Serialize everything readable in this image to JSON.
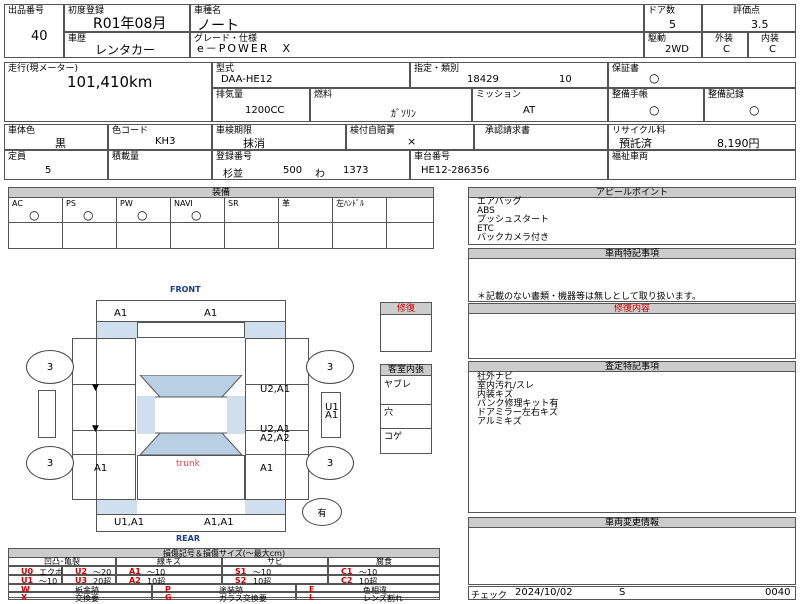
{
  "header": {
    "lot_label": "出品番号",
    "lot_value": "40",
    "first_reg_label": "初度登録",
    "first_reg_value": "R01年08月",
    "car_name_label": "車種名",
    "car_name_value": "ノート",
    "doors_label": "ドア数",
    "doors_value": "5",
    "score_label": "評価点",
    "score_value": "3.5",
    "history_label": "車歴",
    "history_value": "レンタカー",
    "grade_label": "グレード・仕様",
    "grade_value": "e－POWER　X",
    "drive_label": "駆動",
    "drive_value": "2WD",
    "ext_label": "外装",
    "ext_value": "C",
    "int_label": "内装",
    "int_value": "C"
  },
  "spec": {
    "mileage_label": "走行(現メーター)",
    "mileage_value": "101,410km",
    "model_label": "型式",
    "model_value": "DAA-HE12",
    "designation_label": "指定・類別",
    "designation_value1": "18429",
    "designation_value2": "10",
    "warranty_label": "保証書",
    "warranty_value": "○",
    "cc_label": "排気量",
    "cc_value": "1200CC",
    "fuel_label": "燃料",
    "fuel_value": "ｶﾞｿﾘﾝ",
    "mission_label": "ミッション",
    "mission_value": "AT",
    "manual_label": "整備手帳",
    "manual_value": "○",
    "record_label": "整備記録",
    "record_value": "○",
    "color_label": "車体色",
    "color_value": "黒",
    "color_code_label": "色コード",
    "color_code_value": "KH3",
    "inspection_label": "車検期限",
    "inspection_value": "抹消",
    "self_tax_label": "検付自賠責",
    "self_tax_value": "×",
    "approval_label": "承認請求書",
    "approval_value": "",
    "recycle_label": "リサイクル料",
    "recycle_status": "預託済",
    "recycle_value": "8,190円",
    "capacity_label": "定員",
    "capacity_value": "5",
    "load_label": "積載量",
    "load_value": "",
    "plate_label": "登録番号",
    "plate_area": "杉並",
    "plate_class": "500",
    "plate_kana": "わ",
    "plate_num": "1373",
    "chassis_label": "車台番号",
    "chassis_value": "HE12-286356",
    "welfare_label": "福祉車両",
    "welfare_value": ""
  },
  "equipment": {
    "title": "装備",
    "items": [
      {
        "label": "AC",
        "value": "○"
      },
      {
        "label": "PS",
        "value": "○"
      },
      {
        "label": "PW",
        "value": "○"
      },
      {
        "label": "NAVI",
        "value": "○"
      },
      {
        "label": "SR",
        "value": ""
      },
      {
        "label": "革",
        "value": ""
      },
      {
        "label": "左ﾊﾝﾄﾞﾙ",
        "value": ""
      }
    ]
  },
  "appeal": {
    "title": "アピールポイント",
    "lines": [
      "エアバッグ",
      "ABS",
      "プッシュスタート",
      "ETC",
      "バックカメラ付き"
    ]
  },
  "special_notes": {
    "title": "車両特記事項",
    "footer": "＊記載のない書類・機器等は無しとして取り扱います。"
  },
  "repair": {
    "title": "修復内容"
  },
  "inspector_notes": {
    "title": "査定特記事項",
    "lines": [
      "社外ナビ",
      "室内汚れ/スレ",
      "内装キズ",
      "パンク修理キット有",
      "ドアミラー左右キズ",
      "アルミキズ"
    ]
  },
  "change_info": {
    "title": "車両変更情報"
  },
  "diagram": {
    "front_label": "FRONT",
    "rear_label": "REAR",
    "trunk_label": "trunk",
    "repair_box_label": "修復",
    "interior_title": "客室内張",
    "interior_items": [
      "ヤブレ",
      "穴",
      "コゲ"
    ],
    "present_label": "有",
    "tires": {
      "fl": "3",
      "fr": "3",
      "rl": "3",
      "rr": "3"
    },
    "marks": {
      "hood_left": "A1",
      "hood_right": "A1",
      "left_front_door": "",
      "left_mid": "",
      "left_quarter": "A1",
      "right_front_door": "U2,A1",
      "right_rear_door1": "U2,A1",
      "right_rear_door2": "A2,A2",
      "right_quarter": "A1",
      "roof_right_1": "U1",
      "roof_right_2": "A1",
      "rear_left": "U1,A1",
      "rear_right": "A1,A1"
    }
  },
  "legend": {
    "title": "損傷記号＆損傷サイズ(～最大cm)",
    "col_headers": [
      "凹凸･亀裂",
      "線キズ",
      "サビ",
      "腐食"
    ],
    "row1": [
      {
        "code": "U0",
        "desc": "エクボ"
      },
      {
        "code": "U2",
        "desc": "～20"
      },
      {
        "code": "A1",
        "desc": "～10"
      },
      {
        "code": "S1",
        "desc": "～10"
      },
      {
        "code": "C1",
        "desc": "～10"
      }
    ],
    "row2": [
      {
        "code": "U1",
        "desc": "～10"
      },
      {
        "code": "U3",
        "desc": "20超"
      },
      {
        "code": "A2",
        "desc": "10超"
      },
      {
        "code": "S2",
        "desc": "10超"
      },
      {
        "code": "C2",
        "desc": "10超"
      }
    ],
    "row3": [
      {
        "code": "W",
        "desc": "板金跡"
      },
      {
        "code": "P",
        "desc": "塗装跡"
      },
      {
        "code": "E",
        "desc": "色相違"
      }
    ],
    "row4": [
      {
        "code": "X",
        "desc": "交換要"
      },
      {
        "code": "G",
        "desc": "ガラス交換要"
      },
      {
        "code": "L",
        "desc": "レンズ割れ"
      }
    ]
  },
  "check": {
    "label": "チェック",
    "date": "2024/10/02",
    "code": "S",
    "number": "0040"
  }
}
